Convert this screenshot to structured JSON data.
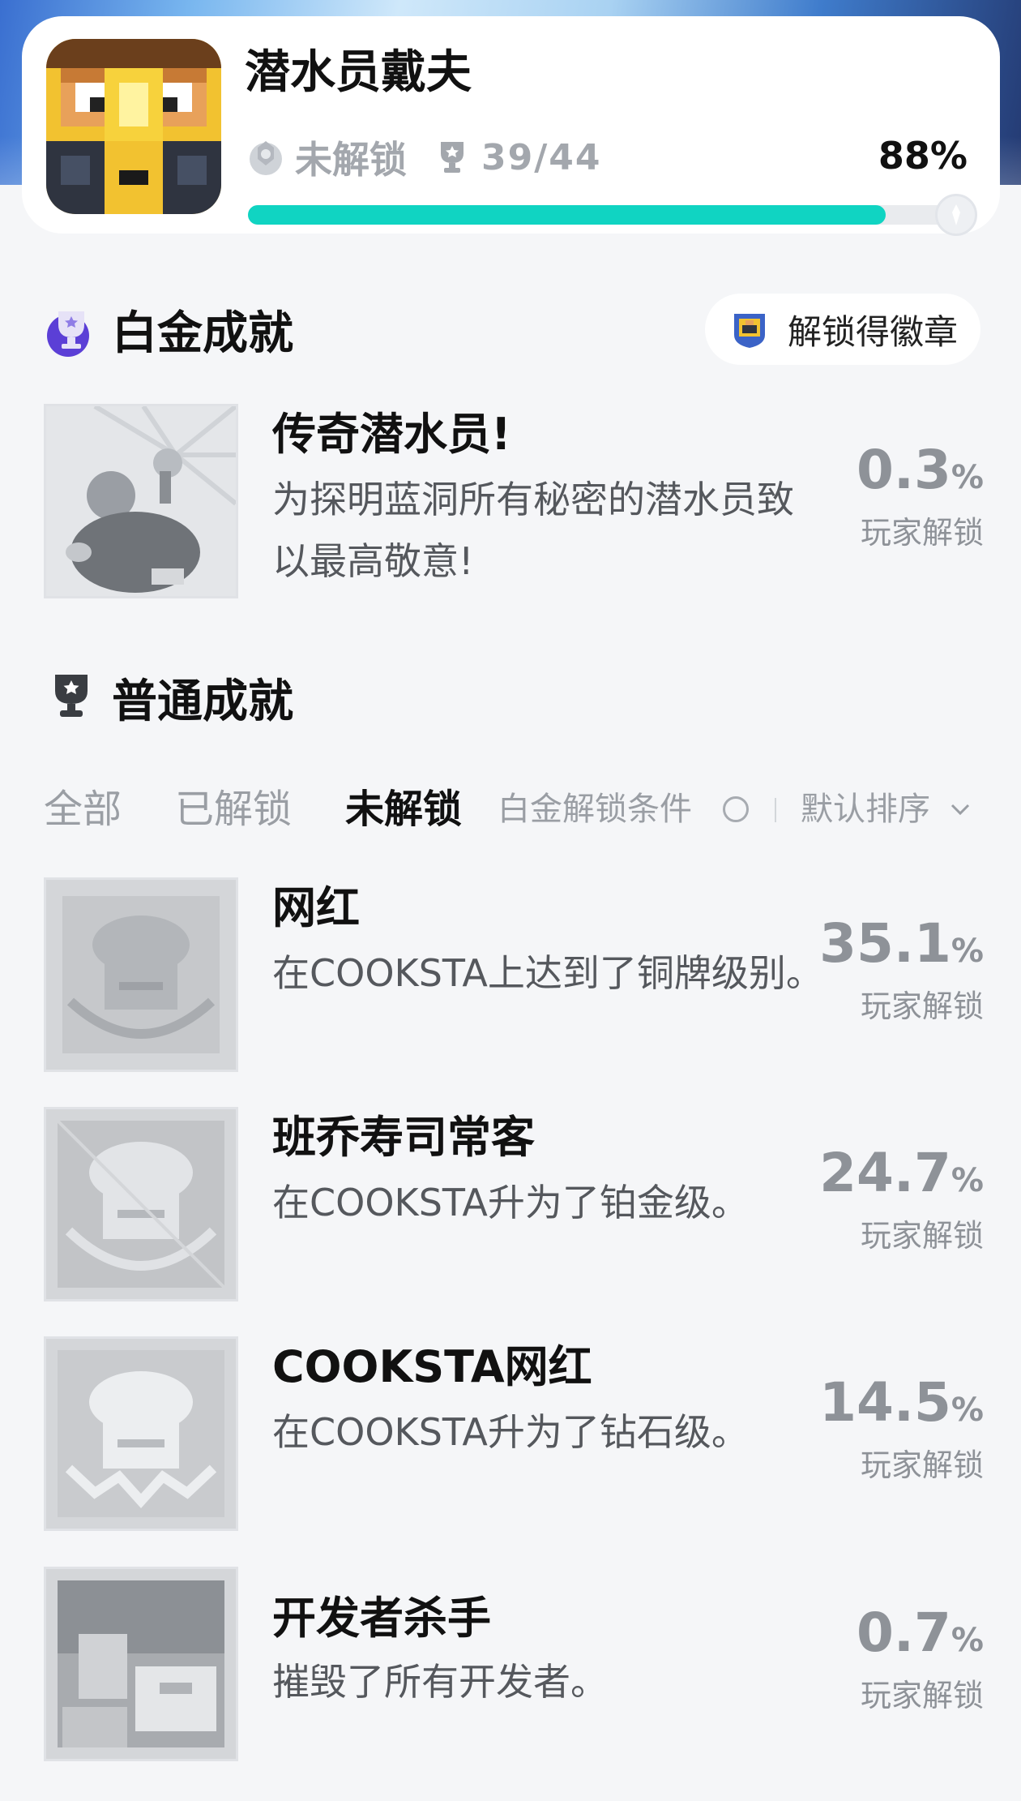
{
  "header": {
    "game_title": "潜水员戴夫",
    "status": "未解锁",
    "trophy_count": "39/44",
    "percent": "88%",
    "progress": 0.88
  },
  "platinum": {
    "title": "白金成就",
    "badge_button": "解锁得徽章",
    "achievement": {
      "name": "传奇潜水员!",
      "desc": "为探明蓝洞所有秘密的潜水员致以最高敬意!",
      "pct": "0.3",
      "unit": "%",
      "label": "玩家解锁"
    }
  },
  "normal": {
    "title": "普通成就",
    "filters": {
      "all": "全部",
      "unlocked": "已解锁",
      "locked": "未解锁",
      "platinum_condition": "白金解锁条件",
      "sort": "默认排序"
    },
    "items": [
      {
        "name": "网红",
        "desc": "在COOKSTA上达到了铜牌级别。",
        "pct": "35.1",
        "unit": "%",
        "label": "玩家解锁"
      },
      {
        "name": "班乔寿司常客",
        "desc": "在COOKSTA升为了铂金级。",
        "pct": "24.7",
        "unit": "%",
        "label": "玩家解锁"
      },
      {
        "name": "COOKSTA网红",
        "desc": "在COOKSTA升为了钻石级。",
        "pct": "14.5",
        "unit": "%",
        "label": "玩家解锁"
      },
      {
        "name": "开发者杀手",
        "desc": "摧毁了所有开发者。",
        "pct": "0.7",
        "unit": "%",
        "label": "玩家解锁"
      }
    ]
  },
  "colors": {
    "progress": "#10d4c2",
    "text_primary": "#111111",
    "text_muted": "#8e9298",
    "background": "#f5f6f8"
  },
  "icons": {
    "status": "lock-badge-icon",
    "trophy": "trophy-icon",
    "platinum": "platinum-trophy-icon",
    "normal": "trophy-icon",
    "sort": "chevron-down-icon"
  }
}
